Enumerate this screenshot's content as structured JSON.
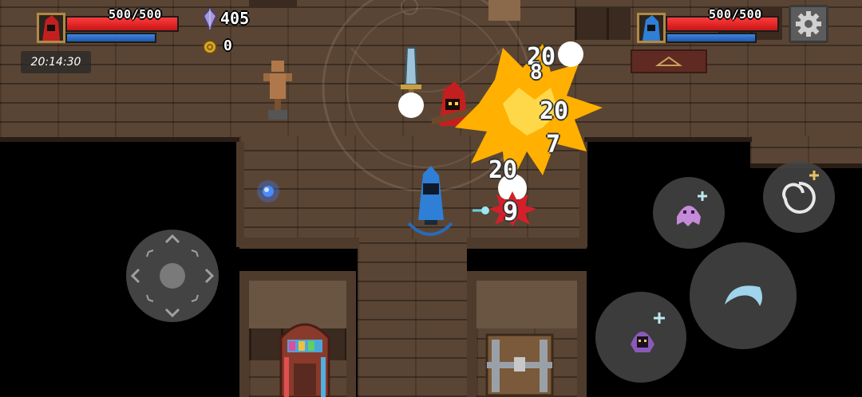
{
  "player1": {
    "hp_text": "500/500",
    "hp_fraction": 1.0,
    "mana_fraction": 1.0,
    "robe_color": "#c41f1f"
  },
  "player2": {
    "hp_text": "500/500",
    "hp_fraction": 1.0,
    "mana_fraction": 1.0,
    "robe_color": "#2f7fd6"
  },
  "resources": {
    "gems": "405",
    "gold": "0"
  },
  "timer": "20:14:30",
  "damage_numbers": [
    "20",
    "8",
    "20",
    "7",
    "20",
    "9"
  ],
  "icons": {
    "settings": "gear-icon",
    "gem": "crystal-gem-icon",
    "gold": "gold-coin-icon",
    "joystick": "dpad-joystick",
    "skill_dash": "wave-arc-icon",
    "skill_summon": "purple-ghost-icon",
    "skill_signature": "crescent-slash-icon",
    "skill_special": "spiral-vortex-icon"
  },
  "colors": {
    "hp": "#e52222",
    "mana": "#2f6fc8",
    "fire": "#ffb000",
    "crit": "#d51f2a"
  }
}
